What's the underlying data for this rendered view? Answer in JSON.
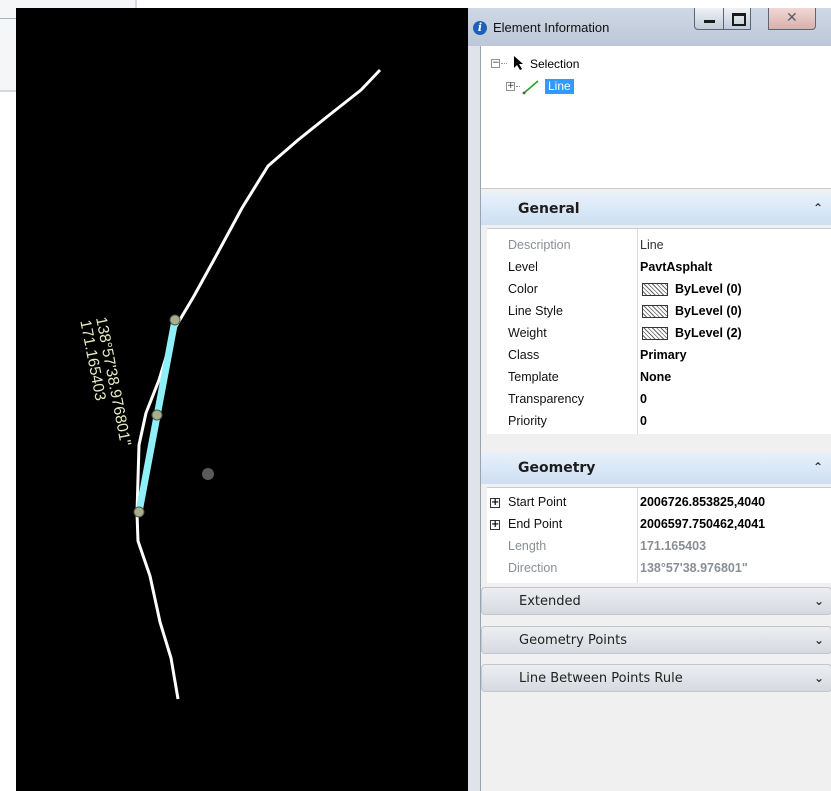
{
  "canvas": {
    "annotation_angle": "138°57'38.976801\"",
    "annotation_length": "171.165403"
  },
  "dialog": {
    "title": "Element Information",
    "icon": "info-icon",
    "tree": {
      "root_label": "Selection",
      "child_label": "Line"
    },
    "sections": {
      "general": {
        "title": "General",
        "expanded": true,
        "rows": [
          {
            "name": "Description",
            "value": "Line"
          },
          {
            "name": "Level",
            "value": "PavtAsphalt"
          },
          {
            "name": "Color",
            "value": "ByLevel (0)"
          },
          {
            "name": "Line Style",
            "value": "ByLevel (0)"
          },
          {
            "name": "Weight",
            "value": "ByLevel (2)"
          },
          {
            "name": "Class",
            "value": "Primary"
          },
          {
            "name": "Template",
            "value": "None"
          },
          {
            "name": "Transparency",
            "value": "0"
          },
          {
            "name": "Priority",
            "value": "0"
          }
        ]
      },
      "geometry": {
        "title": "Geometry",
        "expanded": true,
        "rows": [
          {
            "name": "Start Point",
            "value": "2006726.853825,4040"
          },
          {
            "name": "End Point",
            "value": "2006597.750462,4041"
          },
          {
            "name": "Length",
            "value": "171.165403"
          },
          {
            "name": "Direction",
            "value": "138°57'38.976801\""
          }
        ]
      },
      "extended": {
        "title": "Extended",
        "expanded": false
      },
      "geometry_points": {
        "title": "Geometry Points",
        "expanded": false
      },
      "line_between_points_rule": {
        "title": "Line Between Points Rule",
        "expanded": false
      }
    }
  },
  "colors": {
    "selected_segment": "#8ff0f7",
    "vertex": "#a7b08a",
    "canvas_background": "#000000",
    "annotation_text": "#e6ecc0",
    "selection_highlight": "#3399ff"
  }
}
